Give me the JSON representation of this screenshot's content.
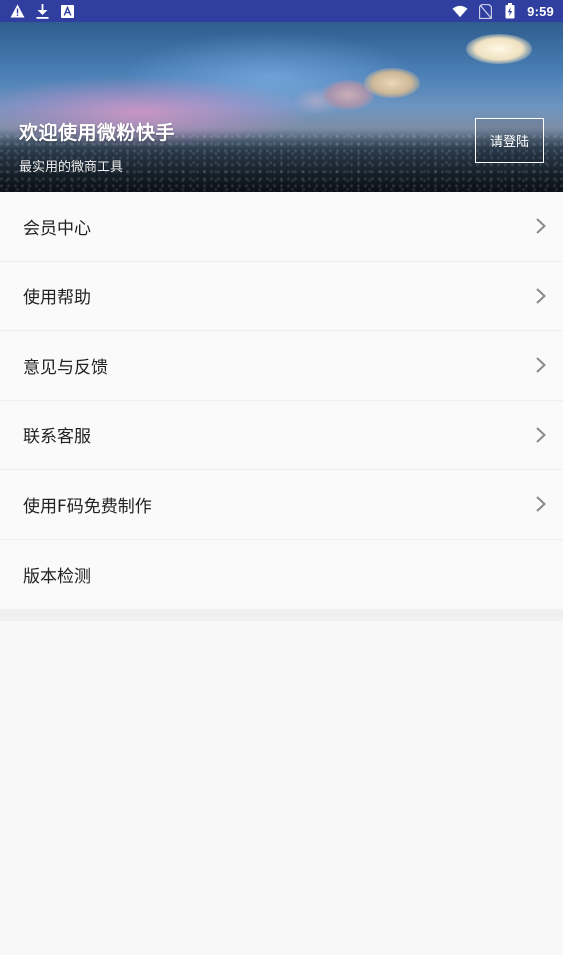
{
  "status_bar": {
    "time": "9:59",
    "left_icons": [
      "warning-icon",
      "download-icon",
      "font-icon"
    ],
    "right_icons": [
      "wifi-icon",
      "no-sim-icon",
      "battery-charging-icon"
    ]
  },
  "header": {
    "title": "欢迎使用微粉快手",
    "subtitle": "最实用的微商工具",
    "login_label": "请登陆"
  },
  "menu": {
    "items": [
      {
        "label": "会员中心",
        "has_arrow": true
      },
      {
        "label": "使用帮助",
        "has_arrow": true
      },
      {
        "label": "意见与反馈",
        "has_arrow": true
      },
      {
        "label": "联系客服",
        "has_arrow": true
      },
      {
        "label": "使用F码免费制作",
        "has_arrow": true
      },
      {
        "label": "版本检测",
        "has_arrow": false
      }
    ]
  },
  "colors": {
    "status_bar": "#303f9f",
    "background": "#f8f8f8",
    "text": "#222222",
    "chevron": "#8a8a8a"
  }
}
